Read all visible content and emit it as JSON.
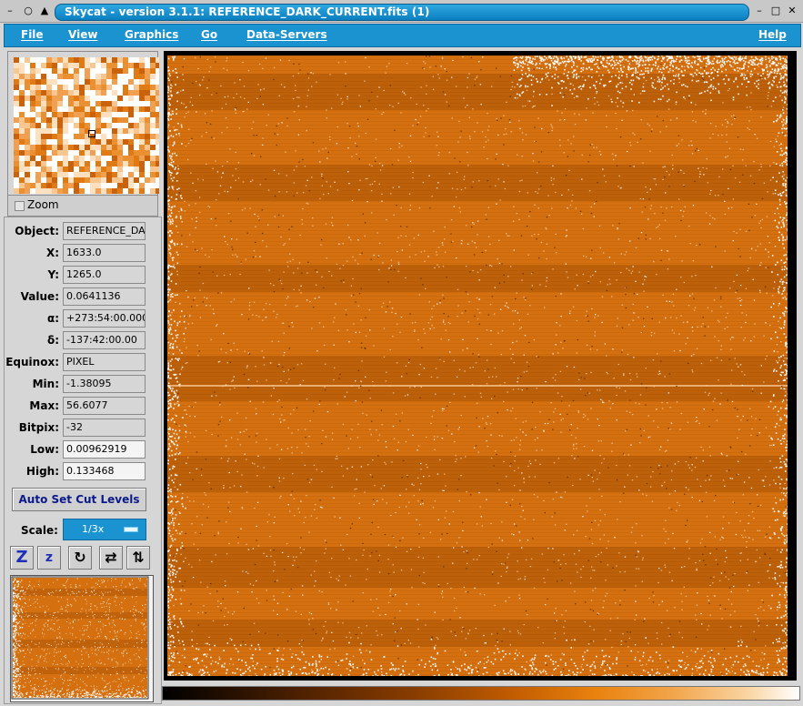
{
  "window": {
    "title": "Skycat - version 3.1.1: REFERENCE_DARK_CURRENT.fits (1)",
    "controls": [
      "–",
      "○",
      "▲",
      "–",
      "□",
      "✕"
    ]
  },
  "menu": {
    "items": [
      "File",
      "View",
      "Graphics",
      "Go",
      "Data-Servers"
    ],
    "help": "Help"
  },
  "zoom": {
    "label": "Zoom"
  },
  "info": {
    "rows": [
      {
        "label": "Object:",
        "value": "REFERENCE_DARK_CURRENT"
      },
      {
        "label": "X:",
        "value": "1633.0"
      },
      {
        "label": "Y:",
        "value": "1265.0"
      },
      {
        "label": "Value:",
        "value": "0.0641136"
      },
      {
        "label": "α:",
        "value": "+273:54:00.000"
      },
      {
        "label": "δ:",
        "value": "-137:42:00.00"
      },
      {
        "label": "Equinox:",
        "value": "PIXEL"
      },
      {
        "label": "Min:",
        "value": "-1.38095"
      },
      {
        "label": "Max:",
        "value": "56.6077"
      },
      {
        "label": "Bitpix:",
        "value": "-32"
      },
      {
        "label": "Low:",
        "value": "0.00962919"
      },
      {
        "label": "High:",
        "value": "0.133468"
      }
    ]
  },
  "cut_levels_button": "Auto Set Cut Levels",
  "scale": {
    "label": "Scale:",
    "value": "1/3x"
  },
  "tools": {
    "zoom_in": "Z",
    "zoom_out": "z",
    "rotate": "↻",
    "flip_x": "⇄",
    "flip_y": "⇅"
  },
  "colors": {
    "accent": "#1a93d0",
    "image_base": "#d4700f",
    "image_dark": "#a04e05"
  }
}
